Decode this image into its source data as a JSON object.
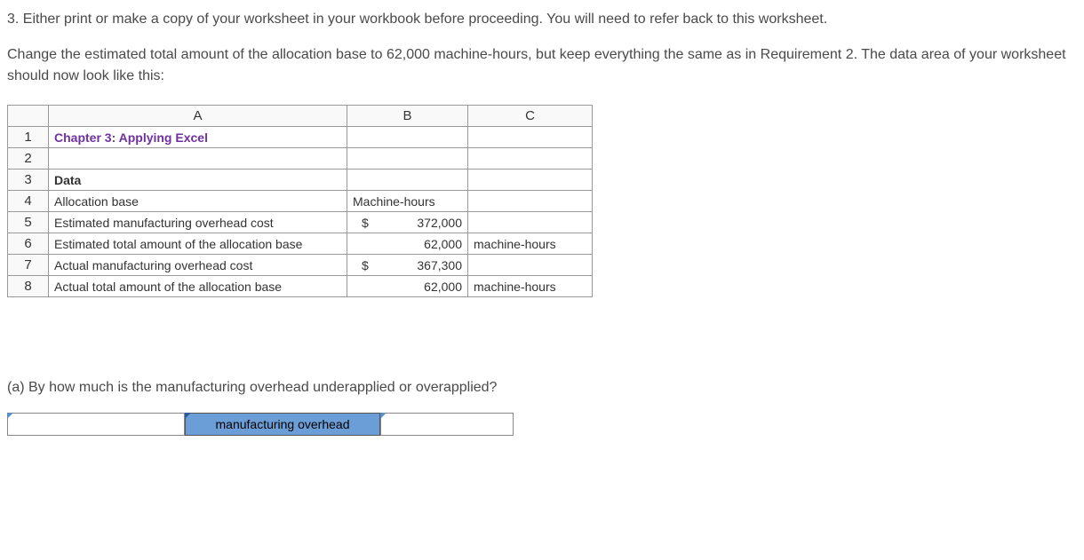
{
  "intro": {
    "line1": "3. Either print or make a copy of your worksheet in your workbook before proceeding. You will need to refer back to this worksheet.",
    "line2": "Change the estimated total amount of the allocation base to 62,000 machine-hours, but keep everything the same as in Requirement 2. The data area of your worksheet should now look like this:"
  },
  "sheet": {
    "headers": {
      "a": "A",
      "b": "B",
      "c": "C"
    },
    "rows": {
      "r1": {
        "num": "1",
        "a": "Chapter 3: Applying Excel",
        "b": "",
        "c": ""
      },
      "r2": {
        "num": "2",
        "a": "",
        "b": "",
        "c": ""
      },
      "r3": {
        "num": "3",
        "a": "Data",
        "b": "",
        "c": ""
      },
      "r4": {
        "num": "4",
        "a": "Allocation base",
        "b": "Machine-hours",
        "c": ""
      },
      "r5": {
        "num": "5",
        "a": "Estimated manufacturing overhead cost",
        "b_dollar": "$",
        "b_val": "372,000",
        "c": ""
      },
      "r6": {
        "num": "6",
        "a": "Estimated total amount of the allocation base",
        "b_val": "62,000",
        "c": "machine-hours"
      },
      "r7": {
        "num": "7",
        "a": "Actual manufacturing overhead cost",
        "b_dollar": "$",
        "b_val": "367,300",
        "c": ""
      },
      "r8": {
        "num": "8",
        "a": "Actual total amount of the allocation base",
        "b_val": "62,000",
        "c": "machine-hours"
      }
    }
  },
  "question": {
    "text": "(a) By how much is the manufacturing overhead underapplied or overapplied?",
    "label": "manufacturing overhead"
  }
}
